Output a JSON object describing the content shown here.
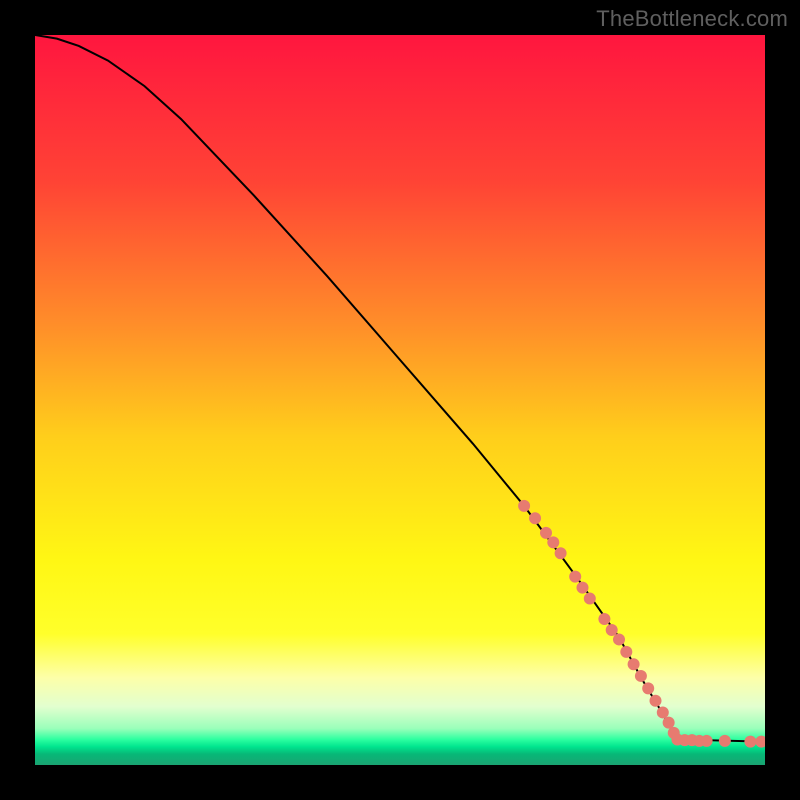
{
  "watermark": "TheBottleneck.com",
  "chart_data": {
    "type": "line",
    "title": "",
    "xlabel": "",
    "ylabel": "",
    "xlim": [
      0,
      100
    ],
    "ylim": [
      0,
      100
    ],
    "grid": false,
    "legend": false,
    "background_gradient": {
      "stops": [
        {
          "pos": 0.0,
          "color": "#ff163f"
        },
        {
          "pos": 0.2,
          "color": "#ff4335"
        },
        {
          "pos": 0.4,
          "color": "#ff8f29"
        },
        {
          "pos": 0.55,
          "color": "#ffce1b"
        },
        {
          "pos": 0.72,
          "color": "#fff714"
        },
        {
          "pos": 0.82,
          "color": "#ffff2a"
        },
        {
          "pos": 0.88,
          "color": "#fdffa8"
        },
        {
          "pos": 0.92,
          "color": "#e2ffcf"
        },
        {
          "pos": 0.95,
          "color": "#9affba"
        },
        {
          "pos": 0.965,
          "color": "#2dffa0"
        },
        {
          "pos": 0.975,
          "color": "#00e58e"
        },
        {
          "pos": 0.985,
          "color": "#07b877"
        },
        {
          "pos": 1.0,
          "color": "#1aa372"
        }
      ]
    },
    "series": [
      {
        "name": "bottleneck-curve",
        "color": "#000000",
        "x": [
          0,
          3,
          6,
          10,
          15,
          20,
          30,
          40,
          50,
          60,
          67,
          74,
          80,
          83,
          86,
          88,
          100
        ],
        "y": [
          100,
          99.5,
          98.5,
          96.5,
          93,
          88.5,
          78,
          67,
          55.5,
          44,
          35.5,
          26,
          17.5,
          12,
          7,
          3.5,
          3.2
        ]
      }
    ],
    "scatter": {
      "name": "highlighted-points",
      "color": "#e77b70",
      "radius_px": 6,
      "points": [
        {
          "x": 67.0,
          "y": 35.5
        },
        {
          "x": 68.5,
          "y": 33.8
        },
        {
          "x": 70.0,
          "y": 31.8
        },
        {
          "x": 71.0,
          "y": 30.5
        },
        {
          "x": 72.0,
          "y": 29.0
        },
        {
          "x": 74.0,
          "y": 25.8
        },
        {
          "x": 75.0,
          "y": 24.3
        },
        {
          "x": 76.0,
          "y": 22.8
        },
        {
          "x": 78.0,
          "y": 20.0
        },
        {
          "x": 79.0,
          "y": 18.5
        },
        {
          "x": 80.0,
          "y": 17.2
        },
        {
          "x": 81.0,
          "y": 15.5
        },
        {
          "x": 82.0,
          "y": 13.8
        },
        {
          "x": 83.0,
          "y": 12.2
        },
        {
          "x": 84.0,
          "y": 10.5
        },
        {
          "x": 85.0,
          "y": 8.8
        },
        {
          "x": 86.0,
          "y": 7.2
        },
        {
          "x": 86.8,
          "y": 5.8
        },
        {
          "x": 87.5,
          "y": 4.4
        },
        {
          "x": 88.0,
          "y": 3.5
        },
        {
          "x": 89.0,
          "y": 3.4
        },
        {
          "x": 90.0,
          "y": 3.4
        },
        {
          "x": 91.0,
          "y": 3.3
        },
        {
          "x": 92.0,
          "y": 3.3
        },
        {
          "x": 94.5,
          "y": 3.3
        },
        {
          "x": 98.0,
          "y": 3.2
        },
        {
          "x": 99.5,
          "y": 3.2
        }
      ]
    }
  }
}
